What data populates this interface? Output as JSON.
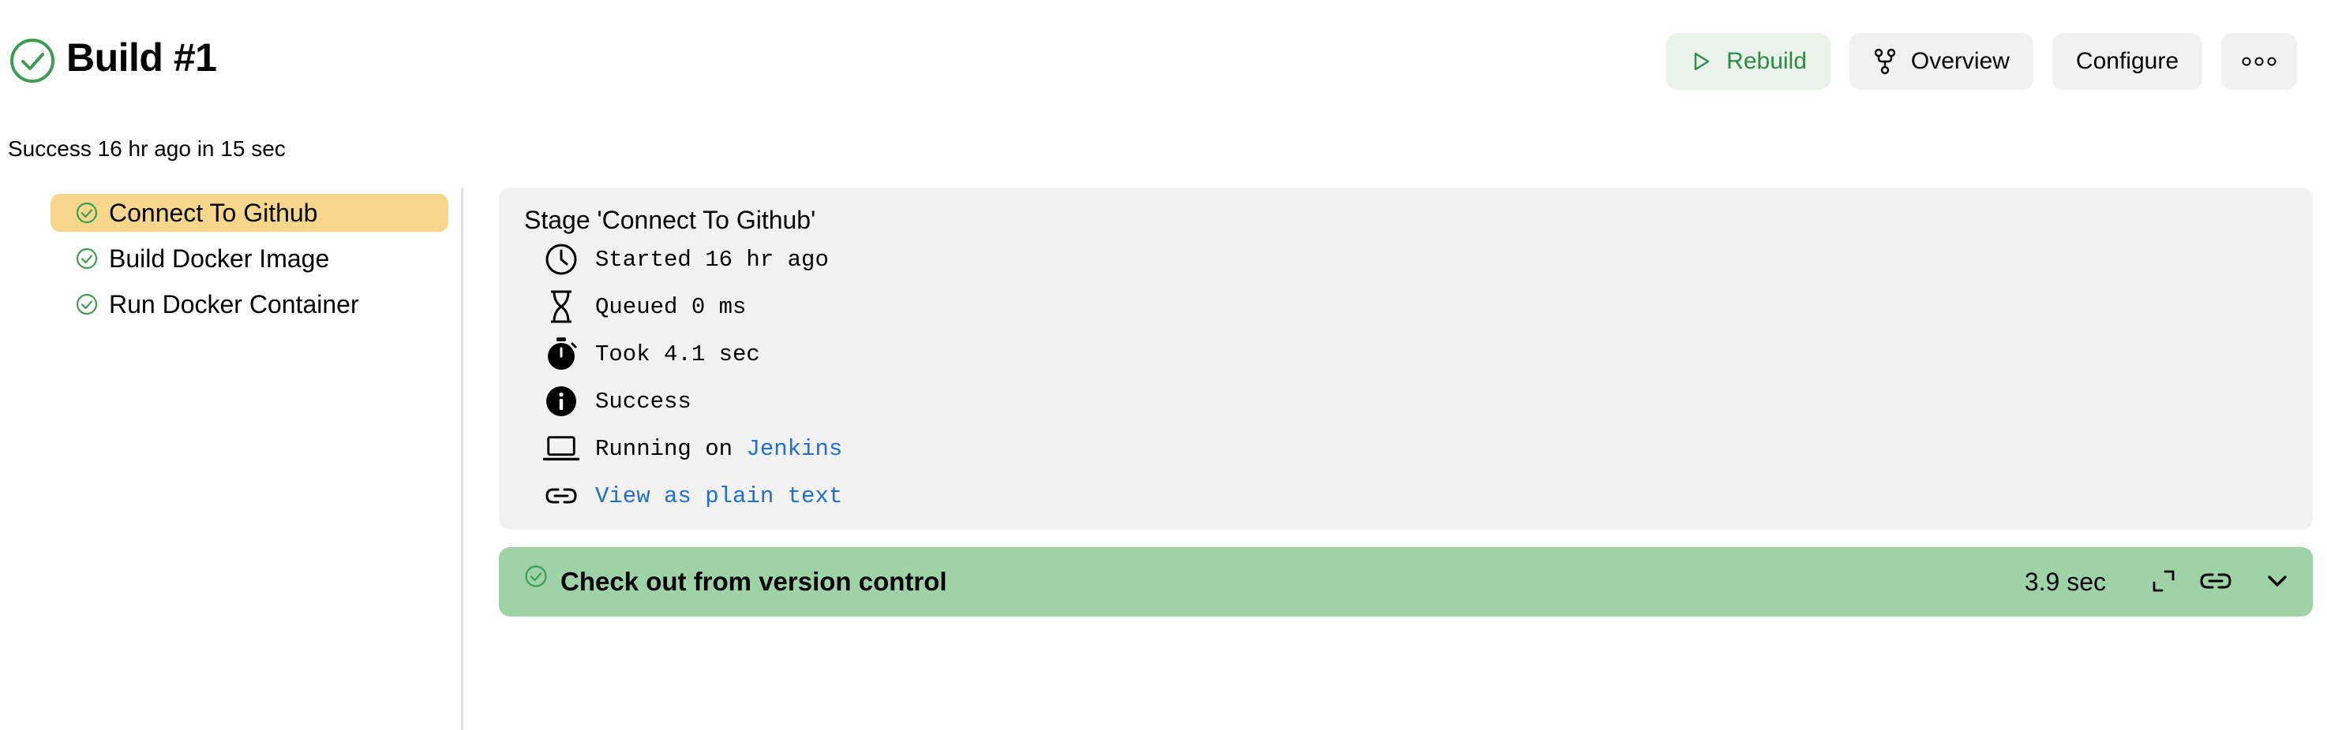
{
  "header": {
    "title": "Build #1",
    "status_line": "Success 16 hr ago in 15 sec",
    "status_icon": "circle-check-icon",
    "success_color": "#3f9b52"
  },
  "actions": {
    "rebuild_label": "Rebuild",
    "overview_label": "Overview",
    "configure_label": "Configure",
    "more_icon": "ellipsis-icon"
  },
  "stages": [
    {
      "label": "Connect To Github",
      "status": "success",
      "selected": true
    },
    {
      "label": "Build Docker Image",
      "status": "success",
      "selected": false
    },
    {
      "label": "Run Docker Container",
      "status": "success",
      "selected": false
    }
  ],
  "details": {
    "title": "Stage 'Connect To Github'",
    "started": "Started 16 hr ago",
    "queued": "Queued 0 ms",
    "took": "Took 4.1 sec",
    "result": "Success",
    "running_prefix": "Running on ",
    "running_node": "Jenkins",
    "plain_text_link": "View as plain text"
  },
  "step": {
    "title": "Check out from version control",
    "duration": "3.9 sec",
    "row_color": "#9ed2a7"
  },
  "colors": {
    "selected_stage": "#f8d68c",
    "panel_bg": "#f2f2f2",
    "link": "#1f6fd1",
    "rebuild_bg": "#e9f3ea"
  }
}
